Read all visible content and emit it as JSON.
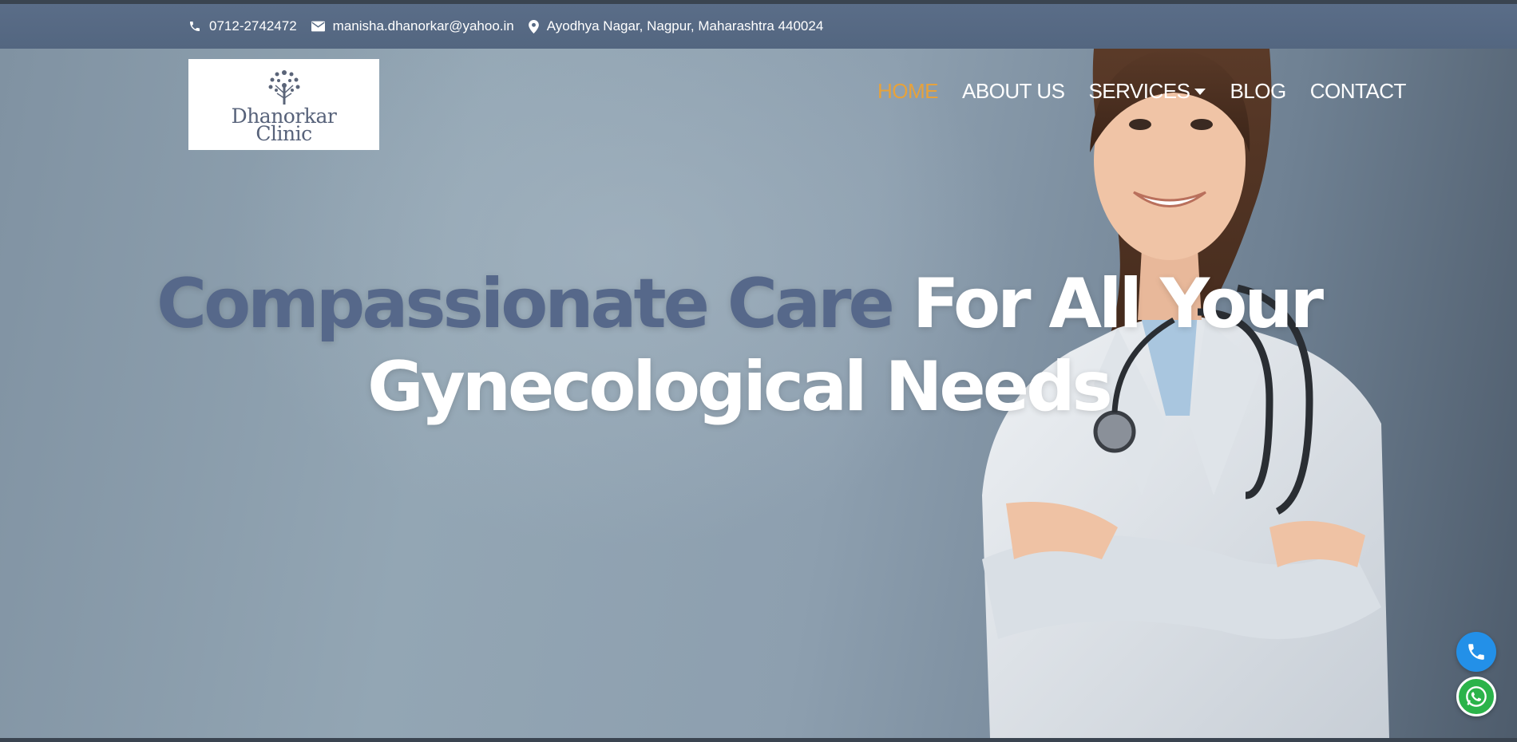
{
  "topbar": {
    "phone": "0712-2742472",
    "email": "manisha.dhanorkar@yahoo.in",
    "address": "Ayodhya Nagar, Nagpur, Maharashtra 440024"
  },
  "logo": {
    "line1": "Dhanorkar",
    "line2": "Clinic"
  },
  "nav": {
    "items": [
      {
        "label": "HOME",
        "active": true
      },
      {
        "label": "ABOUT US"
      },
      {
        "label": "SERVICES",
        "dropdown": true
      },
      {
        "label": "BLOG"
      },
      {
        "label": "CONTACT"
      }
    ]
  },
  "hero": {
    "headline_accent": "Compassionate Care",
    "headline_rest_line1": " For All Your",
    "headline_line2": "Gynecological Needs"
  },
  "colors": {
    "accent": "#56688a",
    "nav_active": "#e6a23c",
    "phone_button": "#2390e8",
    "whatsapp_button": "#2bb34a"
  },
  "icons": [
    "phone-icon",
    "envelope-icon",
    "map-marker-icon",
    "call-icon",
    "whatsapp-icon"
  ]
}
